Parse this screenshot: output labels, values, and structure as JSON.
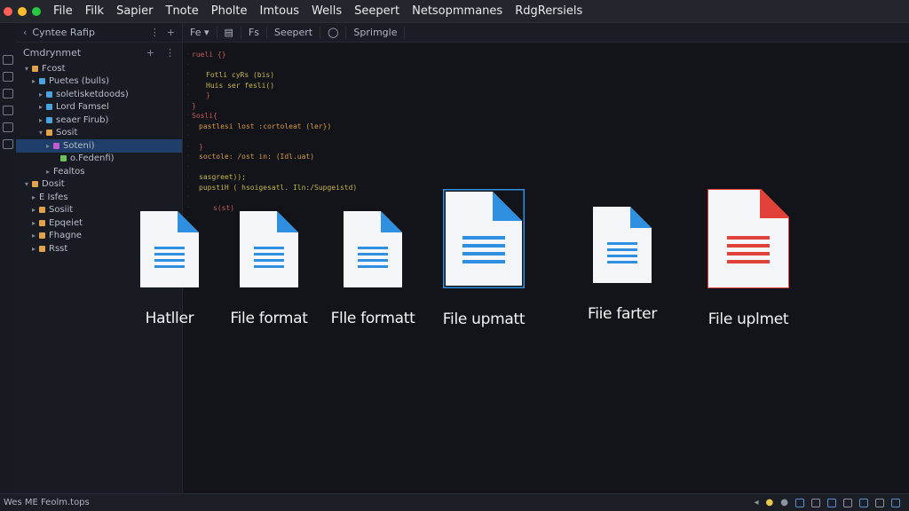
{
  "window": {
    "menu": [
      "File",
      "Filk",
      "Sapier",
      "Tnote",
      "Pholte",
      "Imtous",
      "Wells",
      "Seepert",
      "Netsopmmanes",
      "RdgRersiels"
    ],
    "traffic_colors": [
      "#ff5f56",
      "#ffbd2e",
      "#27c93f"
    ]
  },
  "sidebar": {
    "header": "Cyntee Rafip",
    "subheader": "Cmdrynmet",
    "tree": [
      {
        "label": "Fcost",
        "indent": 1,
        "chev": "▾",
        "color": "#e0a24a"
      },
      {
        "label": "Puetes (bulls)",
        "indent": 2,
        "chev": "▸",
        "color": "#4aa3df"
      },
      {
        "label": "soletisketdoods)",
        "indent": 3,
        "chev": "▸",
        "color": "#4aa3df"
      },
      {
        "label": "Lord Famsel",
        "indent": 3,
        "chev": "▸",
        "color": "#4aa3df"
      },
      {
        "label": "seaer Firub)",
        "indent": 3,
        "chev": "▸",
        "color": "#4aa3df"
      },
      {
        "label": "Sosit",
        "indent": 3,
        "chev": "▾",
        "color": "#e0a24a"
      },
      {
        "label": "Soteni)",
        "indent": 4,
        "chev": "▸",
        "color": "#c45bd1",
        "selected": true
      },
      {
        "label": "o.Fedenfi)",
        "indent": 5,
        "chev": "",
        "color": "#6fbf5a"
      },
      {
        "label": "Fealtos",
        "indent": 4,
        "chev": "▸",
        "color": ""
      },
      {
        "label": "Dosit",
        "indent": 1,
        "chev": "▾",
        "color": "#e0a24a"
      },
      {
        "label": "E Isfes",
        "indent": 2,
        "chev": "▸",
        "color": ""
      },
      {
        "label": "Sosiit",
        "indent": 2,
        "chev": "▸",
        "color": "#e0a24a"
      },
      {
        "label": "Epqeiet",
        "indent": 2,
        "chev": "▸",
        "color": "#e0a24a"
      },
      {
        "label": "Fhagne",
        "indent": 2,
        "chev": "▸",
        "color": "#e0a24a"
      },
      {
        "label": "Rsst",
        "indent": 2,
        "chev": "▸",
        "color": "#e0a24a"
      }
    ]
  },
  "tabs": [
    "Fe ▾",
    "▤",
    "Fs",
    "Seepert",
    "◯",
    "Sprimgle"
  ],
  "code": [
    {
      "text": "rueli {}",
      "color": "#c75a5a",
      "indent": 0
    },
    {
      "text": "",
      "color": "#c75a5a",
      "indent": 0
    },
    {
      "text": "Fotli cyRs (bis)",
      "color": "#c7b54a",
      "indent": 2
    },
    {
      "text": "Huis ser fesli()",
      "color": "#c7b54a",
      "indent": 2
    },
    {
      "text": "}",
      "color": "#c75a5a",
      "indent": 2
    },
    {
      "text": "}",
      "color": "#c75a5a",
      "indent": 0
    },
    {
      "text": "Sosli{",
      "color": "#c75a5a",
      "indent": 0
    },
    {
      "text": "pastlesi lost :cortoleat (ler})",
      "color": "#d69a45",
      "indent": 1
    },
    {
      "text": "",
      "color": "#c75a5a",
      "indent": 0
    },
    {
      "text": "}",
      "color": "#c75a5a",
      "indent": 1
    },
    {
      "text": "soctole: /ost in: (Idl.uat)",
      "color": "#d69a45",
      "indent": 1
    },
    {
      "text": "",
      "color": "#c75a5a",
      "indent": 0
    },
    {
      "text": "sasgreet));",
      "color": "#c7b54a",
      "indent": 1
    },
    {
      "text": "pupstiH ( hsoigesatl. Iln:/Supgeistd)",
      "color": "#c7b54a",
      "indent": 1
    },
    {
      "text": "",
      "color": "#c75a5a",
      "indent": 0
    },
    {
      "text": "s(st)",
      "color": "#c75a5a",
      "indent": 3
    }
  ],
  "files": [
    {
      "label": "Hatller",
      "color": "#2f8fe0",
      "selected": false
    },
    {
      "label": "File format",
      "color": "#2f8fe0",
      "selected": false
    },
    {
      "label": "Flle formatt",
      "color": "#2f8fe0",
      "selected": false
    },
    {
      "label": "File upmatt",
      "color": "#2f8fe0",
      "selected": true
    },
    {
      "label": "Fiie farter",
      "color": "#2f8fe0",
      "selected": false
    },
    {
      "label": "File uplmet",
      "color": "#e0423a",
      "selected": false
    }
  ],
  "status": {
    "left": "Wes ME Feolm.tops"
  }
}
